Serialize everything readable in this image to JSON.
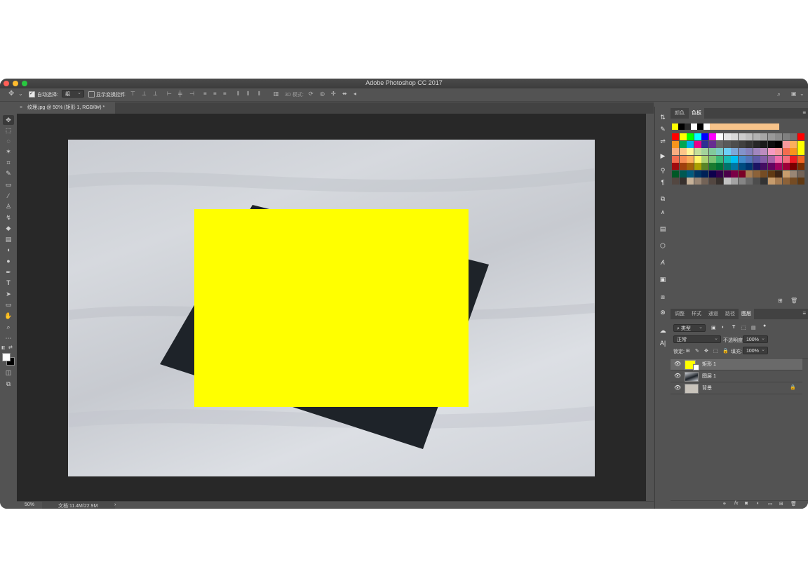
{
  "window": {
    "title": "Adobe Photoshop CC 2017"
  },
  "options": {
    "auto_select_label": "自动选择:",
    "auto_select_value": "组",
    "show_transform_label": "显示变换控件",
    "mode_3d_label": "3D 模式:"
  },
  "document": {
    "tab_label": "纹理.jpg @ 50% (矩形 1, RGB/8#) *"
  },
  "status": {
    "zoom": "50%",
    "doc_info": "文档:11.4M/22.9M"
  },
  "color_panel": {
    "tab_color": "颜色",
    "tab_swatches": "色板"
  },
  "layers_panel": {
    "tabs": [
      "调整",
      "样式",
      "通道",
      "路径",
      "图层"
    ],
    "filter_kind": "类型",
    "blend_mode": "正常",
    "opacity_label": "不透明度:",
    "opacity_value": "100%",
    "lock_label": "锁定:",
    "fill_label": "填充:",
    "fill_value": "100%",
    "layers": [
      {
        "name": "矩形 1"
      },
      {
        "name": "图层 1"
      },
      {
        "name": "背景"
      }
    ]
  },
  "colors": {
    "accent_yellow": "#ffff00",
    "dark_card": "#1e2329"
  }
}
